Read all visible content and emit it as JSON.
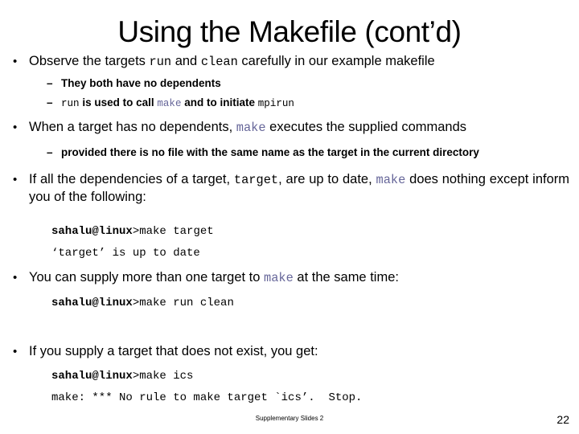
{
  "slide": {
    "title": "Using the Makefile (cont’d)",
    "bullet_glyph": "•",
    "dash_glyph": "–",
    "accent_color": "#666699",
    "text_color": "#000000",
    "background_color": "#ffffff"
  },
  "content": {
    "b1": {
      "pre": "Observe the targets ",
      "code1": "run",
      "mid": " and ",
      "code2": "clean",
      "post": " carefully in our example makefile"
    },
    "b1_sub1": {
      "text": "They both have no dependents"
    },
    "b1_sub2": {
      "code1": "run",
      "mid": " is used to call ",
      "code2": "make",
      "mid2": " and to initiate ",
      "code3": "mpirun"
    },
    "b2": {
      "pre": "When a target has no dependents, ",
      "code1": "make",
      "post": " executes the supplied commands"
    },
    "b2_sub1": {
      "text": "provided there is no file with the same name as the target in the current directory"
    },
    "b3": {
      "pre": "If all the dependencies of a target, ",
      "code1": "target",
      "mid": ", are up to date, ",
      "code2": "make",
      "post": " does nothing except inform you of the following:"
    },
    "console1": {
      "line1_prompt": "sahalu@linux",
      "line1_cmd": ">make target",
      "line2": "‘target’ is up to date"
    },
    "b4": {
      "pre": "You can supply more than one target to ",
      "code1": "make",
      "post": " at the same time:"
    },
    "console2": {
      "line1_prompt": "sahalu@linux",
      "line1_cmd": ">make run clean"
    },
    "b5": {
      "text": "If you supply a target that does not exist, you get:"
    },
    "console3": {
      "line1_prompt": "sahalu@linux",
      "line1_cmd": ">make ics",
      "line2": "make: *** No rule to make target `ics’.  Stop."
    }
  },
  "footer": {
    "note": "Supplementary Slides 2",
    "page_number": "22"
  }
}
